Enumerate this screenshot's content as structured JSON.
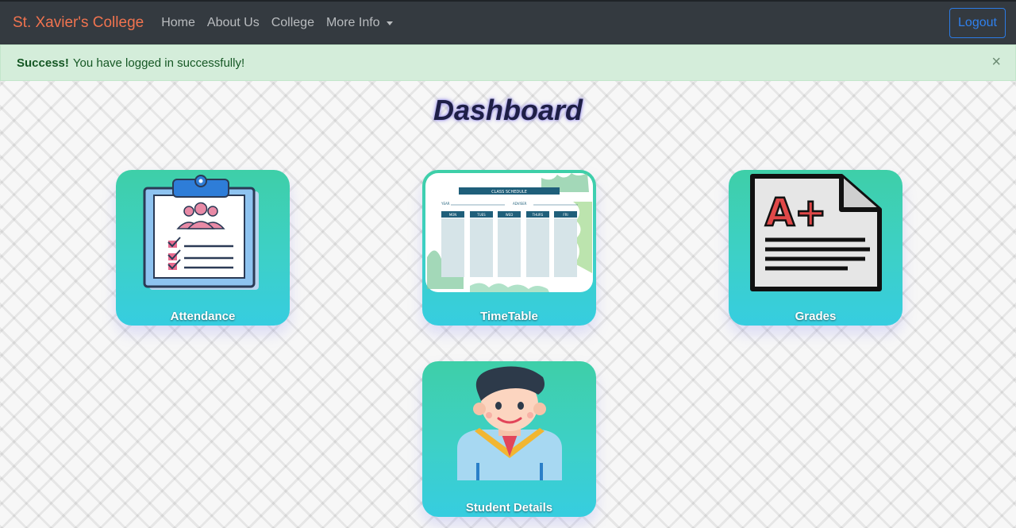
{
  "navbar": {
    "brand": "St. Xavier's College",
    "links": [
      "Home",
      "About Us",
      "College",
      "More Info"
    ],
    "logout": "Logout"
  },
  "alert": {
    "strong": "Success!",
    "message": "You have logged in successfully!",
    "close": "×"
  },
  "page": {
    "title": "Dashboard"
  },
  "cards": [
    {
      "label": "Attendance",
      "icon": "clipboard-checklist-icon"
    },
    {
      "label": "TimeTable",
      "icon": "class-schedule-icon"
    },
    {
      "label": "Grades",
      "icon": "a-plus-grade-icon"
    },
    {
      "label": "Student Details",
      "icon": "student-graduate-icon"
    }
  ],
  "schedule": {
    "heading": "CLASS SCHEDULE",
    "year_label": "YEAR",
    "adviser_label": "ADVISER",
    "days": [
      "MON",
      "TUES",
      "WED",
      "THURS",
      "FRI"
    ]
  },
  "grade": {
    "text": "A+"
  },
  "colors": {
    "navbar": "#343a40",
    "brand": "#f0734f",
    "logout": "#2f80ed",
    "alert_bg": "#d4edda",
    "card_top": "#3ecfa8",
    "card_bottom": "#36cde0"
  }
}
